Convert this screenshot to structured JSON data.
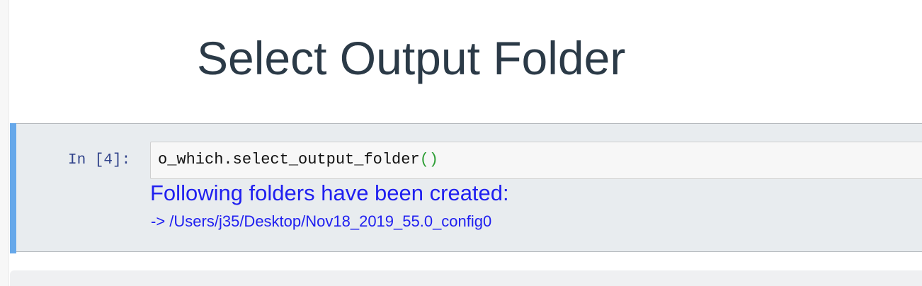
{
  "heading": "Select Output Folder",
  "cell": {
    "prompt": "In [4]:",
    "code": {
      "text": "o_which.select_output_folder",
      "open_paren": "(",
      "close_paren": ")"
    },
    "output": {
      "line1": "Following folders have been created:",
      "line2": "-> /Users/j35/Desktop/Nov18_2019_55.0_config0"
    }
  },
  "colors": {
    "heading": "#2b3a47",
    "prompt": "#30428a",
    "output_text": "#1f1ff0",
    "selected_cell_bar": "#66a8ea",
    "paren": "#2e9e35"
  }
}
